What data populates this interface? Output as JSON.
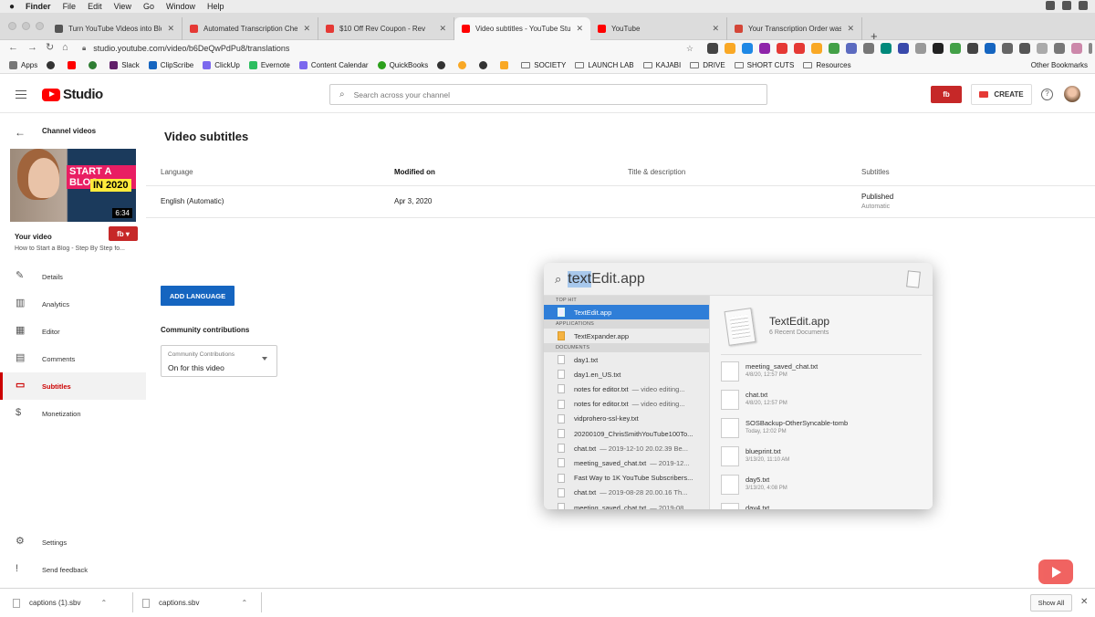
{
  "menubar": {
    "apple": "",
    "items": [
      "Finder",
      "File",
      "Edit",
      "View",
      "Go",
      "Window",
      "Help"
    ]
  },
  "tabs": [
    {
      "title": "Turn YouTube Videos into Blog P",
      "color": "#555555",
      "active": false
    },
    {
      "title": "Automated Transcription Checkc",
      "color": "#e53935",
      "active": false
    },
    {
      "title": "$10 Off Rev Coupon - Rev",
      "color": "#e53935",
      "active": false
    },
    {
      "title": "Video subtitles - YouTube Studio",
      "color": "#ff0000",
      "active": true
    },
    {
      "title": "YouTube",
      "color": "#ff0000",
      "active": false
    },
    {
      "title": "Your Transcription Order was Re",
      "color": "#d44638",
      "active": false
    }
  ],
  "address": {
    "url": "studio.youtube.com/video/b6DeQwPdPu8/translations"
  },
  "bookmarks": [
    {
      "label": "Apps",
      "type": "grid"
    },
    {
      "label": "",
      "type": "icon",
      "color": "#333333"
    },
    {
      "label": "",
      "type": "icon",
      "color": "#ff0000"
    },
    {
      "label": "",
      "type": "icon",
      "color": "#2e7d32"
    },
    {
      "label": "Slack",
      "type": "icon",
      "color": "#611f69"
    },
    {
      "label": "ClipScribe",
      "type": "icon",
      "color": "#1565c0"
    },
    {
      "label": "ClickUp",
      "type": "icon",
      "color": "#7b68ee"
    },
    {
      "label": "Evernote",
      "type": "icon",
      "color": "#2dbe60"
    },
    {
      "label": "Content Calendar",
      "type": "icon",
      "color": "#7b68ee"
    },
    {
      "label": "QuickBooks",
      "type": "icon",
      "color": "#2ca01c"
    },
    {
      "label": "",
      "type": "icon",
      "color": "#333333"
    },
    {
      "label": "",
      "type": "icon",
      "color": "#f9a825"
    },
    {
      "label": "",
      "type": "icon",
      "color": "#333333"
    },
    {
      "label": "",
      "type": "icon",
      "color": "#f9a825"
    },
    {
      "label": "SOCIETY",
      "type": "folder"
    },
    {
      "label": "LAUNCH LAB",
      "type": "folder"
    },
    {
      "label": "KAJABI",
      "type": "folder"
    },
    {
      "label": "DRIVE",
      "type": "folder"
    },
    {
      "label": "SHORT CUTS",
      "type": "folder"
    },
    {
      "label": "Resources",
      "type": "folder"
    }
  ],
  "other_bookmarks": "Other Bookmarks",
  "studio": {
    "logo": "Studio",
    "search_placeholder": "Search across your channel",
    "fb_label": "fb",
    "create": "CREATE",
    "help": "?"
  },
  "sidebar": {
    "back_label": "Channel videos",
    "thumb": {
      "line1": "START A BLOG",
      "line2": "IN 2020",
      "duration": "6:34"
    },
    "your_video": "Your video",
    "video_title": "How to Start a Blog - Step By Step fo...",
    "fb_label": "fb",
    "items": [
      {
        "label": "Details",
        "icon": "pencil-icon",
        "glyph": "✎"
      },
      {
        "label": "Analytics",
        "icon": "analytics-icon",
        "glyph": "▥"
      },
      {
        "label": "Editor",
        "icon": "editor-icon",
        "glyph": "▦"
      },
      {
        "label": "Comments",
        "icon": "comments-icon",
        "glyph": "▤"
      },
      {
        "label": "Subtitles",
        "icon": "subtitles-icon",
        "glyph": "▭",
        "active": true
      },
      {
        "label": "Monetization",
        "icon": "dollar-icon",
        "glyph": "$"
      }
    ],
    "bottom": [
      {
        "label": "Settings",
        "icon": "gear-icon",
        "glyph": "⚙"
      },
      {
        "label": "Send feedback",
        "icon": "feedback-icon",
        "glyph": "!"
      }
    ]
  },
  "main": {
    "title": "Video subtitles",
    "columns": [
      "Language",
      "Modified on",
      "Title & description",
      "Subtitles"
    ],
    "row": {
      "language": "English (Automatic)",
      "modified": "Apr 3, 2020",
      "title_desc": "",
      "subtitles": "Published",
      "subtitles_sub": "Automatic"
    },
    "add_language": "ADD LANGUAGE",
    "community_heading": "Community contributions",
    "community_select": {
      "label": "Community Contributions",
      "value": "On for this video"
    }
  },
  "spotlight": {
    "query_selected": "text",
    "query_rest": "Edit.app",
    "sections": {
      "top_hit": "TOP HIT",
      "applications": "APPLICATIONS",
      "documents": "DOCUMENTS"
    },
    "top_hit": "TextEdit.app",
    "applications": [
      "TextExpander.app"
    ],
    "documents": [
      {
        "name": "day1.txt",
        "detail": ""
      },
      {
        "name": "day1.en_US.txt",
        "detail": ""
      },
      {
        "name": "notes for editor.txt",
        "detail": "— video editing..."
      },
      {
        "name": "notes for editor.txt",
        "detail": "— video editing..."
      },
      {
        "name": "vidprohero-ssl-key.txt",
        "detail": ""
      },
      {
        "name": "20200109_ChrisSmithYouTube100To...",
        "detail": ""
      },
      {
        "name": "chat.txt",
        "detail": "— 2019-12-10 20.02.39 Be..."
      },
      {
        "name": "meeting_saved_chat.txt",
        "detail": "— 2019-12..."
      },
      {
        "name": "Fast Way to 1K YouTube Subscribers...",
        "detail": ""
      },
      {
        "name": "chat.txt",
        "detail": "— 2019-08-28 20.00.16 Th..."
      },
      {
        "name": "meeting_saved_chat.txt",
        "detail": "— 2019-08..."
      }
    ],
    "preview": {
      "title": "TextEdit.app",
      "subtitle": "6 Recent Documents",
      "recent": [
        {
          "name": "meeting_saved_chat.txt",
          "date": "4/8/20, 12:57 PM"
        },
        {
          "name": "chat.txt",
          "date": "4/8/20, 12:57 PM"
        },
        {
          "name": "SOSBackup-OtherSyncable-tomb",
          "date": "Today, 12:02 PM"
        },
        {
          "name": "blueprint.txt",
          "date": "3/13/20, 11:10 AM"
        },
        {
          "name": "day5.txt",
          "date": "3/13/20, 4:08 PM"
        },
        {
          "name": "day4.txt",
          "date": ""
        }
      ]
    }
  },
  "downloads": {
    "items": [
      "captions (1).sbv",
      "captions.sbv"
    ],
    "show_all": "Show All",
    "close": "✕"
  }
}
